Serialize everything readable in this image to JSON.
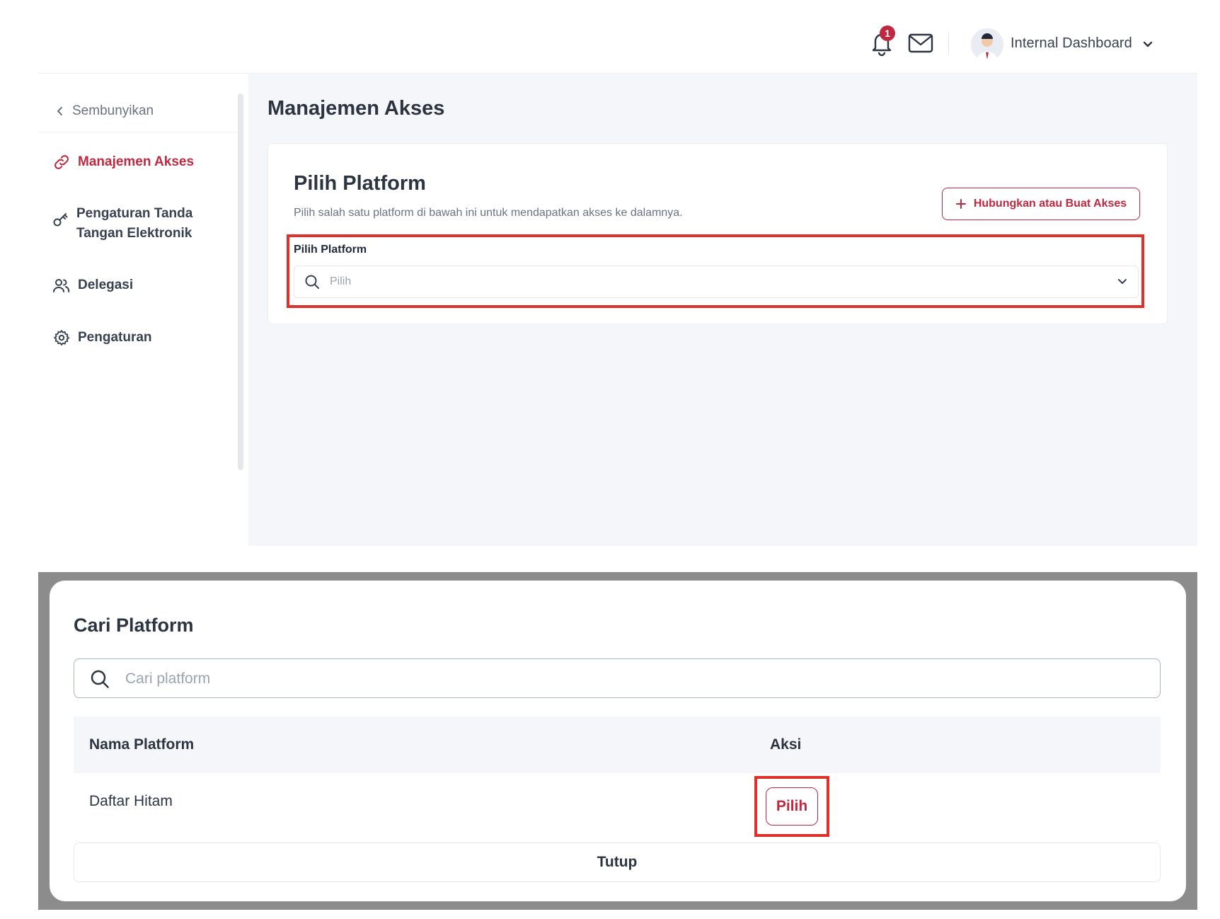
{
  "header": {
    "notification_count": "1",
    "user_name": "Internal Dashboard"
  },
  "sidebar": {
    "hide_label": "Sembunyikan",
    "items": [
      {
        "label": "Manajemen Akses",
        "icon": "link-icon",
        "active": true
      },
      {
        "label": "Pengaturan Tanda Tangan Elektronik",
        "icon": "key-icon",
        "active": false
      },
      {
        "label": "Delegasi",
        "icon": "users-icon",
        "active": false
      },
      {
        "label": "Pengaturan",
        "icon": "gear-icon",
        "active": false
      }
    ]
  },
  "main": {
    "page_title": "Manajemen Akses",
    "card": {
      "title": "Pilih Platform",
      "subtitle": "Pilih salah satu platform di bawah ini untuk mendapatkan akses ke dalamnya.",
      "connect_button": "Hubungkan atau Buat Akses",
      "field_label": "Pilih Platform",
      "select_placeholder": "Pilih"
    }
  },
  "modal": {
    "title": "Cari Platform",
    "search_placeholder": "Cari platform",
    "columns": [
      "Nama Platform",
      "Aksi"
    ],
    "rows": [
      {
        "name": "Daftar Hitam",
        "action": "Pilih"
      }
    ],
    "close_button": "Tutup"
  },
  "colors": {
    "brand": "#c0283f",
    "highlight": "#e0302a"
  }
}
